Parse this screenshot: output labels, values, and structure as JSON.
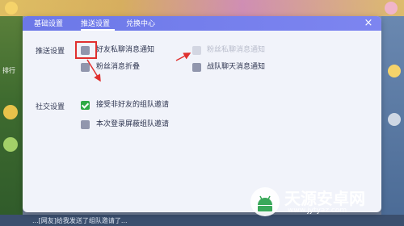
{
  "tabs": [
    {
      "label": "基础设置",
      "active": false
    },
    {
      "label": "推送设置",
      "active": true
    },
    {
      "label": "兑换中心",
      "active": false
    }
  ],
  "close_label": "×",
  "push_section": {
    "label": "推送设置",
    "options": [
      {
        "label": "好友私聊消息通知",
        "checked": false,
        "disabled": false
      },
      {
        "label": "粉丝私聊消息通知",
        "checked": false,
        "disabled": true
      },
      {
        "label": "粉丝消息折叠",
        "checked": false,
        "disabled": false
      },
      {
        "label": "战队聊天消息通知",
        "checked": false,
        "disabled": false
      }
    ]
  },
  "social_section": {
    "label": "社交设置",
    "options": [
      {
        "label": "接受非好友的组队邀请",
        "checked": true
      },
      {
        "label": "本次登录屏蔽组队邀请",
        "checked": false
      }
    ]
  },
  "background": {
    "left_label": "排行",
    "bottom_message": "...[网友]给我发送了组队邀请了..."
  },
  "watermark": {
    "title": "天源安卓网",
    "url": "www.jytyaz.com"
  },
  "colors": {
    "tab_bar": "#6c78e8",
    "checkbox": "#9196ad",
    "checkbox_checked": "#2faa45",
    "highlight": "#e0302f"
  }
}
